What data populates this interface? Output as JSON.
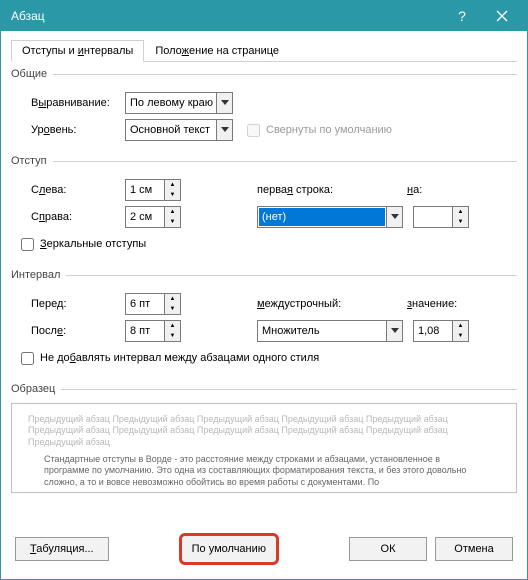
{
  "titlebar": {
    "title": "Абзац"
  },
  "tabs": {
    "active": "Отступы и интервалы",
    "t1_pre": "Отступы и ",
    "t1_u": "и",
    "t1_rest": "нтервалы",
    "t2_pre": "Поло",
    "t2_u": "ж",
    "t2_rest": "ение на странице"
  },
  "general": {
    "legend": "Общие",
    "align_pre": "В",
    "align_u": "ы",
    "align_rest": "равнивание:",
    "align_val": "По левому краю",
    "level_pre": "Ур",
    "level_u": "о",
    "level_rest": "вень:",
    "level_val": "Основной текст",
    "collapsed": "Свернуты по умолчанию"
  },
  "indent": {
    "legend": "Отступ",
    "left_pre": "С",
    "left_u": "л",
    "left_rest": "ева:",
    "left_val": "1 см",
    "right_pre": "С",
    "right_u": "п",
    "right_rest": "рава:",
    "right_val": "2 см",
    "first_pre": "перва",
    "first_u": "я",
    "first_rest": " строка:",
    "first_val": "(нет)",
    "by_u": "н",
    "by_rest": "а:",
    "by_val": "",
    "mirror_u": "З",
    "mirror_rest": "еркальные отступы"
  },
  "spacing": {
    "legend": "Интервал",
    "before_pre": "Пере",
    "before_u": "д",
    "before_rest": ":",
    "before_val": "6 пт",
    "after_pre": "Посл",
    "after_u": "е",
    "after_rest": ":",
    "after_val": "8 пт",
    "line_u": "м",
    "line_rest": "еждустрочный:",
    "line_val": "Множитель",
    "at_u": "з",
    "at_rest": "начение:",
    "at_val": "1,08",
    "nosame_pre": "Не до",
    "nosame_u": "б",
    "nosame_rest": "авлять интервал между абзацами одного стиля"
  },
  "sample": {
    "legend": "Образец",
    "ghost": "Предыдущий абзац Предыдущий абзац Предыдущий абзац Предыдущий абзац Предыдущий абзац Предыдущий абзац Предыдущий абзац Предыдущий абзац Предыдущий абзац Предыдущий абзац Предыдущий абзац",
    "main": "Стандартные отступы в Ворде - это расстояние между строками и абзацами, установленное в программе по умолчанию. Это одна из составляющих форматирования текста, и без этого довольно сложно, а то и вовсе невозможно обойтись во время работы с документами. По"
  },
  "footer": {
    "tabs_pre": "",
    "tabs_u": "Т",
    "tabs_rest": "абуляция...",
    "default": "По умолчанию",
    "ok": "ОК",
    "cancel": "Отмена"
  }
}
